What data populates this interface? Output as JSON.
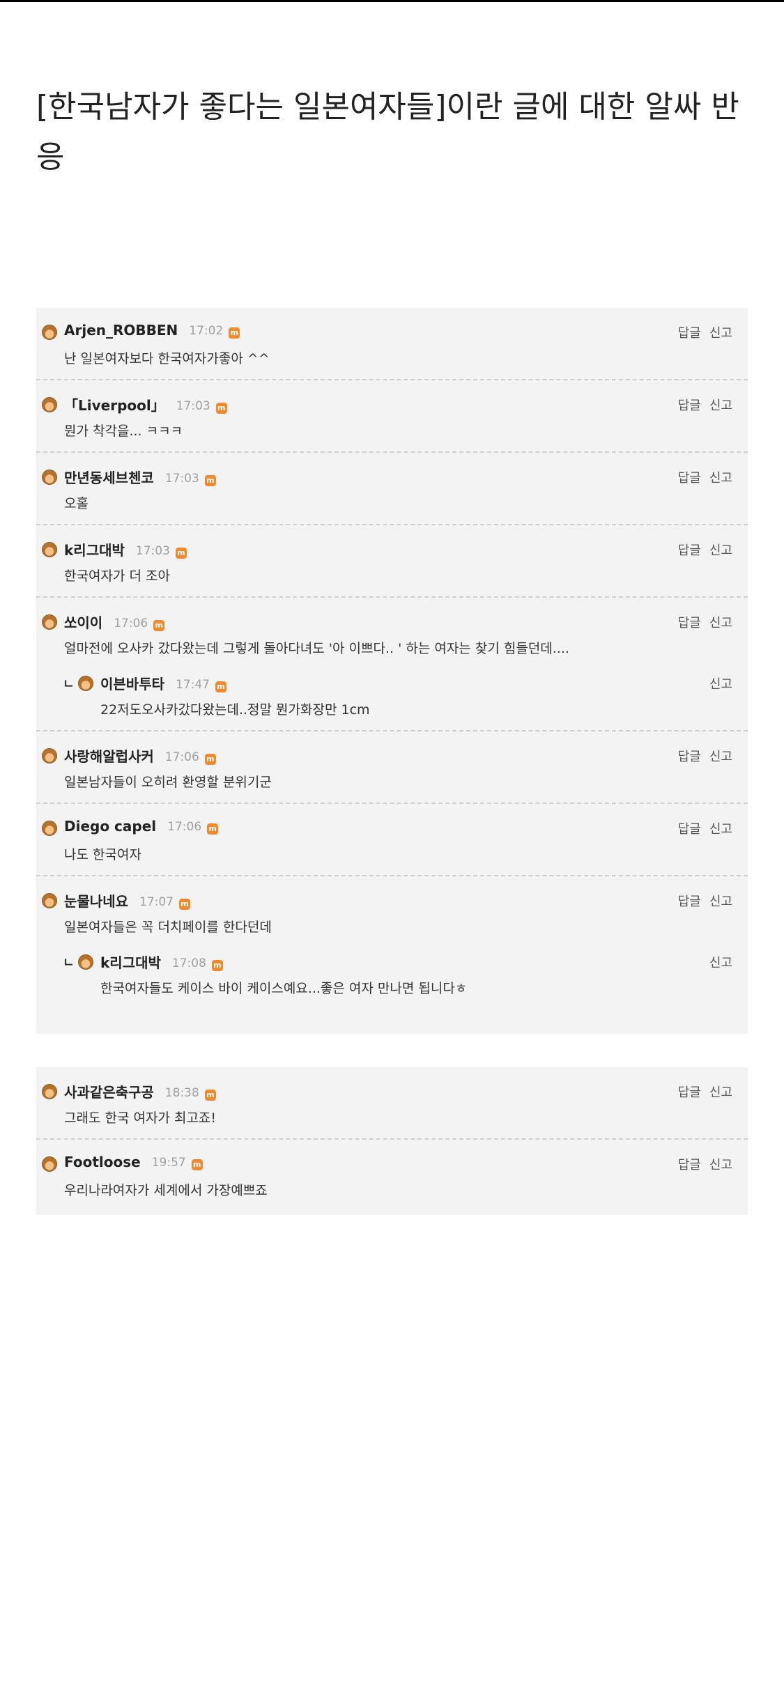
{
  "title": "[한국남자가 좋다는 일본여자들]이란 글에 대한 알싸 반응",
  "actions": {
    "reply": "답글",
    "report": "신고"
  },
  "badge_glyph": "m",
  "colors": {
    "box_bg": "#f3f3f3",
    "badge": "#ef8a2f",
    "time": "#a0a0a0"
  },
  "comments": [
    {
      "nick": "Arjen_ROBBEN",
      "time": "17:02",
      "text": "난 일본여자보다 한국여자가좋아 ^^"
    },
    {
      "nick": "「Liverpool」",
      "time": "17:03",
      "text": "뭔가 착각을... ㅋㅋㅋ"
    },
    {
      "nick": "만년동세브첸코",
      "time": "17:03",
      "text": "오홀"
    },
    {
      "nick": "k리그대박",
      "time": "17:03",
      "text": "한국여자가 더 조아"
    },
    {
      "nick": "쏘이이",
      "time": "17:06",
      "text": "얼마전에 오사카 갔다왔는데 그렇게 돌아다녀도 '아 이쁘다.. ' 하는 여자는 찾기 힘들던데....",
      "reply": {
        "arrow": "ㄴ",
        "nick": "이븐바투타",
        "time": "17:47",
        "text": "22저도오사카갔다왔는데..정말 뭔가화장만 1cm"
      }
    },
    {
      "nick": "사랑해알럽사커",
      "time": "17:06",
      "text": "일본남자들이 오히려 환영할 분위기군"
    },
    {
      "nick": "Diego capel",
      "time": "17:06",
      "text": "나도 한국여자"
    },
    {
      "nick": "눈물나네요",
      "time": "17:07",
      "text": "일본여자들은 꼭 더치페이를 한다던데",
      "reply": {
        "arrow": "ㄴ",
        "nick": "k리그대박",
        "time": "17:08",
        "text": "한국여자들도 케이스 바이 케이스예요...좋은 여자 만나면 됩니다ㅎ"
      }
    },
    {
      "nick": "사과같은축구공",
      "time": "18:38",
      "text": "그래도 한국 여자가 최고죠!"
    },
    {
      "nick": "Footloose",
      "time": "19:57",
      "text": "우리나라여자가 세계에서 가장예쁘죠"
    }
  ]
}
